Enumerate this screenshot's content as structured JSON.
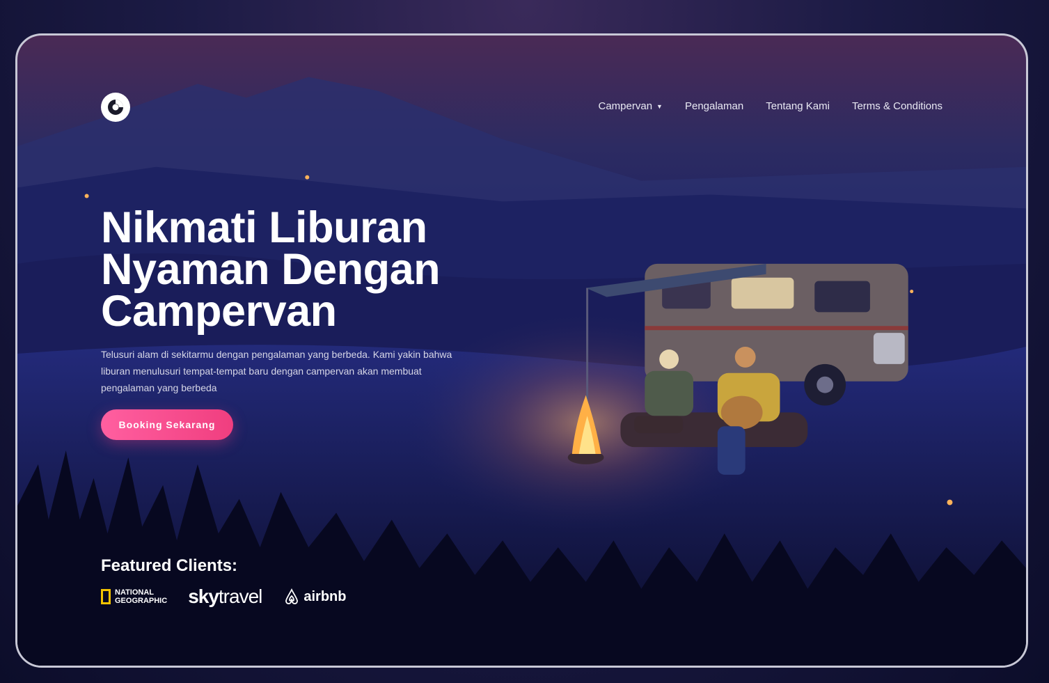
{
  "nav": {
    "items": [
      {
        "label": "Campervan",
        "has_dropdown": true
      },
      {
        "label": "Pengalaman"
      },
      {
        "label": "Tentang Kami"
      },
      {
        "label": "Terms & Conditions"
      }
    ],
    "dropdown_icon": "chevron-down-icon"
  },
  "hero": {
    "title_line1": "Nikmati Liburan",
    "title_line2": "Nyaman Dengan",
    "title_line3": "Campervan",
    "description": "Telusuri alam di sekitarmu dengan pengalaman yang berbeda. Kami yakin bahwa liburan menulusuri tempat-tempat baru dengan campervan akan membuat pengalaman yang berbeda",
    "cta_label": "Booking Sekarang"
  },
  "clients": {
    "title": "Featured Clients:",
    "natgeo": "NATIONAL\nGEOGRAPHIC",
    "sky_bold": "sky",
    "sky_thin": "travel",
    "airbnb": "airbnb"
  },
  "colors": {
    "accent": "#f03e7f",
    "natgeo_yellow": "#f3c300"
  }
}
